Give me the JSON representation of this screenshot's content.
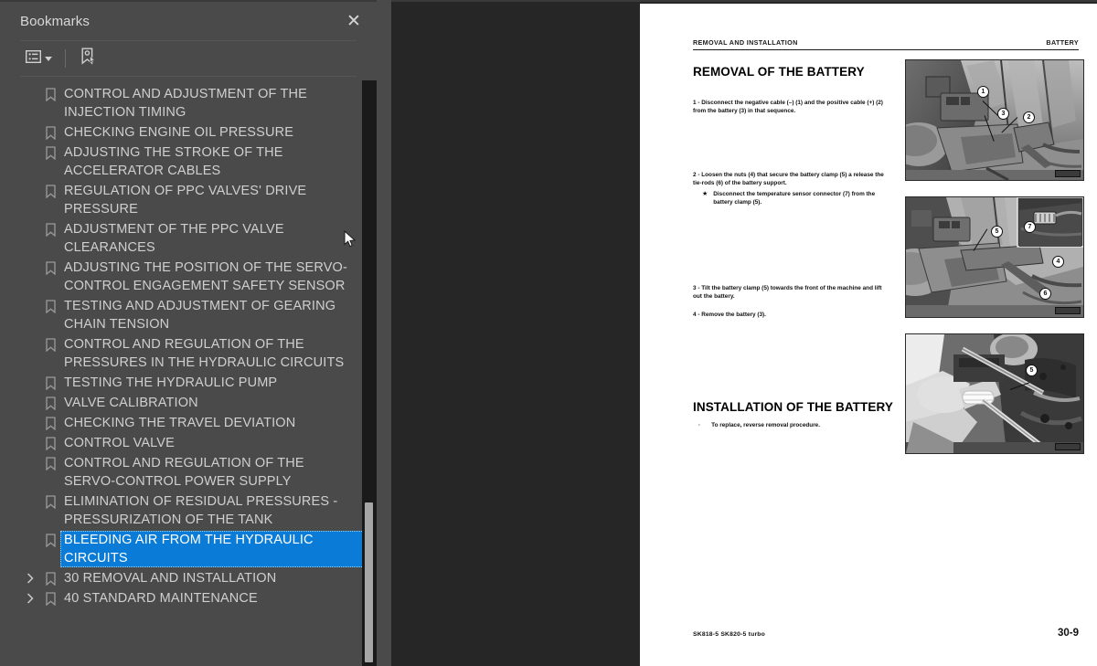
{
  "panel": {
    "title": "Bookmarks",
    "close_icon": "close-icon",
    "toolbar": {
      "options_icon": "list-options-icon",
      "options_caret_icon": "chevron-down-icon",
      "new_bookmark_icon": "new-bookmark-icon"
    },
    "items": [
      {
        "label": "CONTROL AND ADJUSTMENT OF THE INJECTION TIMING",
        "depth": 1,
        "twisty": "",
        "selected": false
      },
      {
        "label": "CHECKING ENGINE OIL PRESSURE",
        "depth": 1,
        "twisty": "",
        "selected": false
      },
      {
        "label": "ADJUSTING THE STROKE OF THE ACCELERATOR CABLES",
        "depth": 1,
        "twisty": "",
        "selected": false
      },
      {
        "label": "REGULATION OF PPC VALVES' DRIVE PRESSURE",
        "depth": 1,
        "twisty": "",
        "selected": false
      },
      {
        "label": "ADJUSTMENT OF THE PPC VALVE CLEARANCES",
        "depth": 1,
        "twisty": "",
        "selected": false
      },
      {
        "label": "ADJUSTING THE POSITION OF THE SERVO-CONTROL ENGAGEMENT SAFETY SENSOR",
        "depth": 1,
        "twisty": "",
        "selected": false
      },
      {
        "label": "TESTING AND ADJUSTMENT OF GEARING CHAIN TENSION",
        "depth": 1,
        "twisty": "",
        "selected": false
      },
      {
        "label": "CONTROL AND REGULATION OF THE PRESSURES IN THE HYDRAULIC CIRCUITS",
        "depth": 1,
        "twisty": "",
        "selected": false
      },
      {
        "label": "TESTING THE HYDRAULIC PUMP",
        "depth": 1,
        "twisty": "",
        "selected": false
      },
      {
        "label": "VALVE CALIBRATION",
        "depth": 1,
        "twisty": "",
        "selected": false
      },
      {
        "label": "CHECKING THE TRAVEL DEVIATION",
        "depth": 1,
        "twisty": "",
        "selected": false
      },
      {
        "label": "CONTROL VALVE",
        "depth": 1,
        "twisty": "",
        "selected": false
      },
      {
        "label": "CONTROL AND REGULATION OF THE SERVO-CONTROL POWER SUPPLY",
        "depth": 1,
        "twisty": "",
        "selected": false
      },
      {
        "label": "ELIMINATION OF RESIDUAL PRESSURES - PRESSURIZATION OF THE TANK",
        "depth": 1,
        "twisty": "",
        "selected": false
      },
      {
        "label": "BLEEDING AIR FROM THE HYDRAULIC CIRCUITS",
        "depth": 1,
        "twisty": "",
        "selected": true
      },
      {
        "label": "30 REMOVAL AND INSTALLATION",
        "depth": 0,
        "twisty": "collapsed",
        "selected": false
      },
      {
        "label": "40 STANDARD MAINTENANCE",
        "depth": 0,
        "twisty": "collapsed",
        "selected": false
      }
    ]
  },
  "splitter": {
    "collapse_icon": "collapse-left-arrow-icon"
  },
  "page": {
    "running_head_left": "REMOVAL AND INSTALLATION",
    "running_head_right": "BATTERY",
    "section_title": "REMOVAL OF THE BATTERY",
    "steps": [
      {
        "num": "1 -",
        "text": "Disconnect the negative cable (–) (1) and the positive cable (+) (2) from the battery (3) in that sequence.",
        "substeps": []
      },
      {
        "num": "2 -",
        "text": "Loosen the nuts (4) that secure the battery clamp (5) a release the tie-rods (6) of the battery support.",
        "substeps": [
          {
            "marker": "★",
            "text": "Disconnect the temperature sensor connector (7) from the battery clamp (5)."
          }
        ]
      },
      {
        "num": "3 -",
        "text": "Tilt the battery clamp (5) towards the front of the machine and lift out the battery.",
        "substeps": []
      },
      {
        "num": "4 -",
        "text": "Remove the battery (3).",
        "substeps": []
      }
    ],
    "install_title": "INSTALLATION OF THE BATTERY",
    "install_bullet_marker": "·",
    "install_bullet_text": "To replace, reverse removal procedure.",
    "figures": [
      {
        "name": "battery-cables-photo",
        "callouts": [
          "1",
          "3",
          "2"
        ]
      },
      {
        "name": "battery-clamp-photo",
        "callouts": [
          "5",
          "7",
          "4",
          "6"
        ]
      },
      {
        "name": "battery-lift-photo",
        "callouts": [
          "5"
        ]
      }
    ],
    "footer_model": "SK818-5  SK820-5 turbo",
    "footer_page": "30-9"
  },
  "colors": {
    "panel_bg": "#4a4a4a",
    "viewer_bg": "#262626",
    "selection_blue": "#0a7bd6",
    "text": "#cfcfcf"
  }
}
